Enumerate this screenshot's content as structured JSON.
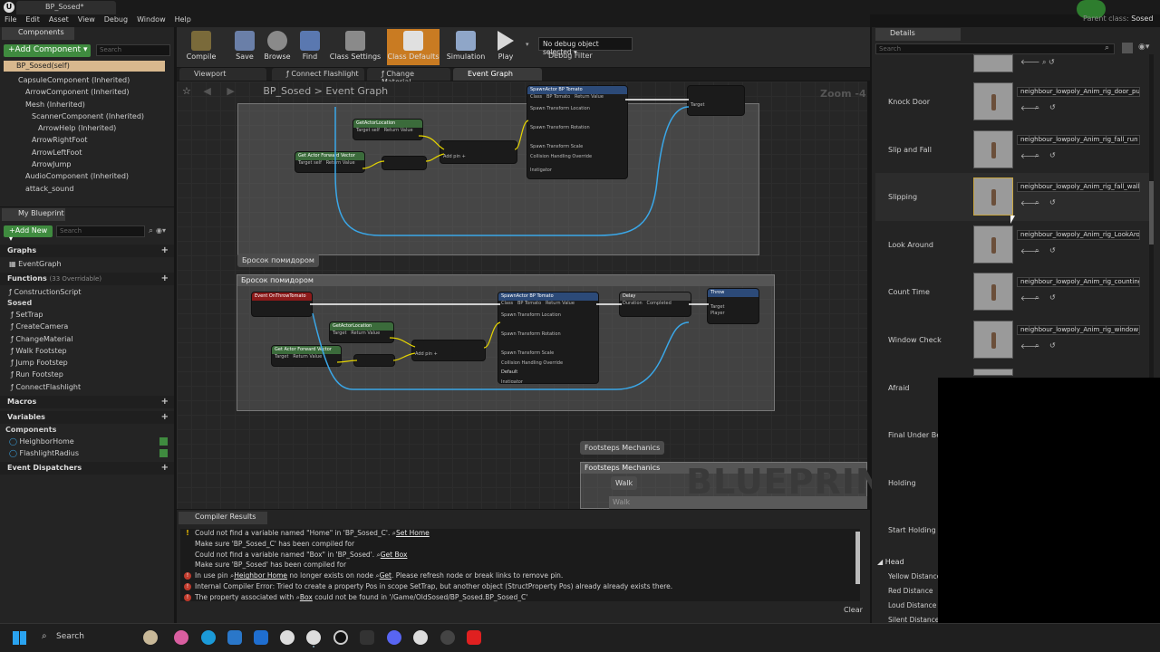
{
  "window": {
    "tab_title": "BP_Sosed*",
    "parent_class_label": "Parent class:",
    "parent_class_value": "Sosed"
  },
  "menu": [
    "File",
    "Edit",
    "Asset",
    "View",
    "Debug",
    "Window",
    "Help"
  ],
  "components": {
    "tab": "Components",
    "add_label": "+Add Component ▾",
    "search_placeholder": "Search",
    "self_row": "BP_Sosed(self)",
    "tree": [
      "CapsuleComponent (Inherited)",
      "ArrowComponent (Inherited)",
      "Mesh (Inherited)",
      "ScannerComponent (Inherited)",
      "ArrowHelp (Inherited)",
      "ArrowRightFoot",
      "ArrowLeftFoot",
      "ArrowJump",
      "AudioComponent (Inherited)",
      "attack_sound"
    ]
  },
  "my_blueprint": {
    "tab": "My Blueprint",
    "add_label": "+Add New ▾",
    "search_placeholder": "Search",
    "graphs_label": "Graphs",
    "graphs": [
      "EventGraph"
    ],
    "functions_label": "Functions",
    "functions_count": "(33 Overridable)",
    "functions": [
      "ConstructionScript"
    ],
    "sosed_label": "Sosed",
    "sosed_items": [
      "SetTrap",
      "CreateCamera",
      "ChangeMaterial",
      "Walk Footstep",
      "Jump Footstep",
      "Run Footstep",
      "ConnectFlashlight"
    ],
    "macros_label": "Macros",
    "variables_label": "Variables",
    "components_label": "Components",
    "variables": [
      "HeighborHome",
      "FlashlightRadius"
    ],
    "dispatchers_label": "Event Dispatchers"
  },
  "toolbar": {
    "buttons": [
      "Compile",
      "Save",
      "Browse",
      "Find",
      "Class Settings",
      "Class Defaults",
      "Simulation",
      "Play"
    ],
    "debug_select": "No debug object selected ▾",
    "debug_label": "Debug Filter"
  },
  "graph_tabs": [
    "Viewport",
    "Connect Flashlight",
    "Change Material",
    "Event Graph"
  ],
  "graph": {
    "breadcrumb": "BP_Sosed  >  Event Graph",
    "zoom": "Zoom -4",
    "watermark": "BLUEPRINT",
    "comment1_bubble": "Бросок помидором",
    "comment1_header": "Бросок помидором",
    "comment2_bubble": "Footsteps Mechanics",
    "comment2_header": "Footsteps Mechanics",
    "walk_bubble": "Walk",
    "walk_label": "Walk",
    "nodes": {
      "get_location": "GetActorLocation",
      "forward_vector": "Get Actor Forward Vector",
      "spawn_actor": "SpawnActor BP Tomato",
      "event_throw": "Event OnThrowTomato",
      "delay": "Delay",
      "throw": "Throw",
      "completed": "Completed",
      "duration": "Duration",
      "target": "Target",
      "return_value": "Return Value",
      "class": "Class",
      "spawn_loc": "Spawn Transform Location",
      "spawn_rot": "Spawn Transform Rotation",
      "spawn_scale": "Spawn Transform Scale",
      "collision": "Collision Handling Override",
      "default": "Default",
      "instigator": "Instigator",
      "self": "self",
      "player": "Player",
      "tomato": "BP Tomato",
      "add_pin": "Add pin +"
    }
  },
  "compiler": {
    "tab": "Compiler Results",
    "clear": "Clear",
    "messages": [
      {
        "type": "warn",
        "text": "Could not find a variable named \"Home\" in 'BP_Sosed_C'.",
        "link": "Set Home"
      },
      {
        "type": "none",
        "text": "Make sure 'BP_Sosed_C' has been compiled for"
      },
      {
        "type": "none",
        "text": "Could not find a variable named \"Box\" in 'BP_Sosed'.",
        "link": "Get Box"
      },
      {
        "type": "none",
        "text": "Make sure 'BP_Sosed' has been compiled for"
      },
      {
        "type": "err",
        "pre": "In use pin",
        "link": "Heighbor Home",
        "mid": "no longer exists on node",
        "link2": "Get",
        "post": ". Please refresh node or break links to remove pin."
      },
      {
        "type": "err",
        "text": "Internal Compiler Error: Tried to create a property Pos in scope SetTrap, but another object (StructProperty Pos) already already exists there."
      },
      {
        "type": "err",
        "pre": "The property associated with",
        "link": "Box",
        "post": "could not be found in '/Game/OldSosed/BP_Sosed.BP_Sosed_C'"
      }
    ]
  },
  "details": {
    "tab": "Details",
    "search_placeholder": "Search",
    "rows": [
      {
        "label": "Knock Door",
        "asset": "neighbour_lowpoly_Anim_rig_door_push ▾"
      },
      {
        "label": "Slip and Fall",
        "asset": "neighbour_lowpoly_Anim_rig_fall_run ▾"
      },
      {
        "label": "Slipping",
        "asset": "neighbour_lowpoly_Anim_rig_fall_walk ▾"
      },
      {
        "label": "Look Around",
        "asset": "neighbour_lowpoly_Anim_rig_LookArou ▾"
      },
      {
        "label": "Count Time",
        "asset": "neighbour_lowpoly_Anim_rig_counting ▾"
      },
      {
        "label": "Window Check",
        "asset": "neighbour_lowpoly_Anim_rig_window_c ▾"
      },
      {
        "label": "Afraid",
        "asset": ""
      },
      {
        "label": "Final Under Bed",
        "asset": ""
      },
      {
        "label": "Holding",
        "asset": ""
      },
      {
        "label": "Start Holding",
        "asset": ""
      }
    ],
    "head_section": "Head",
    "head_rows": [
      "Yellow Distance",
      "Red Distance",
      "Loud Distance",
      "Silent Distance"
    ]
  },
  "taskbar": {
    "search": "Search"
  },
  "colors": {
    "accent_orange": "#c97b22",
    "add_green": "#3f8b3f",
    "wire_blue": "#3aa7e8",
    "error_red": "#c0392b",
    "warn_yellow": "#e6b800"
  }
}
